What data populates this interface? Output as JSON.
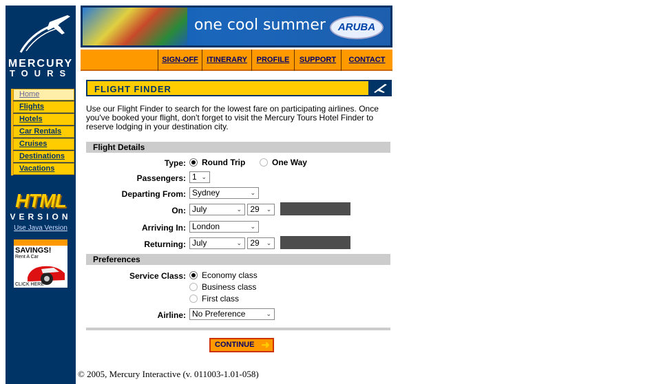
{
  "sidebar": {
    "logo_line1": "MERCURY",
    "logo_line2": "TOURS",
    "nav": [
      {
        "label": "Home"
      },
      {
        "label": "Flights"
      },
      {
        "label": "Hotels"
      },
      {
        "label": "Car Rentals"
      },
      {
        "label": "Cruises"
      },
      {
        "label": "Destinations"
      },
      {
        "label": "Vacations"
      }
    ],
    "html_logo": "HTML",
    "version_word": "VERSION",
    "java_link": "Use Java Version",
    "ad": {
      "title": "SAVINGS!",
      "subtitle": "Rent A Car",
      "cta": "CLICK HERE"
    }
  },
  "banner": {
    "text": "one cool summer",
    "badge": "ARUBA"
  },
  "topnav": {
    "signoff": "SIGN-OFF",
    "itinerary": "ITINERARY",
    "profile": "PROFILE",
    "support": "SUPPORT",
    "contact": "CONTACT"
  },
  "main": {
    "title": "FLIGHT FINDER",
    "intro": "Use our Flight Finder to search for the lowest fare on participating airlines. Once you've booked your flight, don't forget to visit the Mercury Tours Hotel Finder to reserve lodging in your destination city.",
    "flight_details": {
      "header": "Flight Details",
      "type_label": "Type:",
      "round_trip": "Round Trip",
      "one_way": "One Way",
      "passengers_label": "Passengers:",
      "passengers_value": "1",
      "departing_label": "Departing From:",
      "departing_value": "Sydney",
      "on_label": "On:",
      "on_month": "July",
      "on_day": "29",
      "arriving_label": "Arriving In:",
      "arriving_value": "London",
      "returning_label": "Returning:",
      "return_month": "July",
      "return_day": "29"
    },
    "preferences": {
      "header": "Preferences",
      "service_label": "Service Class:",
      "economy": "Economy class",
      "business": "Business class",
      "first": "First class",
      "airline_label": "Airline:",
      "airline_value": "No Preference"
    },
    "continue_label": "CONTINUE"
  },
  "footer": "© 2005, Mercury Interactive (v. 011003-1.01-058)",
  "colors": {
    "navy": "#003366",
    "gold": "#ffcc00",
    "orange": "#ff9900"
  }
}
